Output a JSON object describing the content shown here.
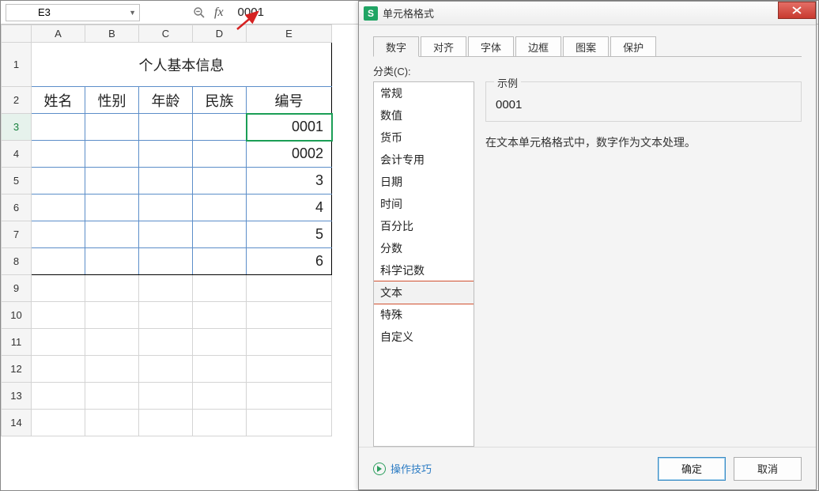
{
  "formula_bar": {
    "cell_ref": "E3",
    "fx_label": "fx",
    "value": "0001"
  },
  "columns": [
    "A",
    "B",
    "C",
    "D",
    "E"
  ],
  "row_headers": [
    1,
    2,
    3,
    4,
    5,
    6,
    7,
    8,
    9,
    10,
    11,
    12,
    13,
    14
  ],
  "selected_row_header": 3,
  "table": {
    "title": "个人基本信息",
    "headers": [
      "姓名",
      "性别",
      "年龄",
      "民族",
      "编号"
    ],
    "rows": [
      [
        "",
        "",
        "",
        "",
        "0001"
      ],
      [
        "",
        "",
        "",
        "",
        "0002"
      ],
      [
        "",
        "",
        "",
        "",
        "3"
      ],
      [
        "",
        "",
        "",
        "",
        "4"
      ],
      [
        "",
        "",
        "",
        "",
        "5"
      ],
      [
        "",
        "",
        "",
        "",
        "6"
      ]
    ]
  },
  "dialog": {
    "app_icon_letter": "S",
    "title": "单元格格式",
    "tabs": [
      "数字",
      "对齐",
      "字体",
      "边框",
      "图案",
      "保护"
    ],
    "active_tab": 0,
    "category_label": "分类(C):",
    "categories": [
      "常规",
      "数值",
      "货币",
      "会计专用",
      "日期",
      "时间",
      "百分比",
      "分数",
      "科学记数",
      "文本",
      "特殊",
      "自定义"
    ],
    "selected_category_index": 9,
    "example_legend": "示例",
    "example_value": "0001",
    "description": "在文本单元格格式中，数字作为文本处理。",
    "tips_label": "操作技巧",
    "ok_label": "确定",
    "cancel_label": "取消"
  }
}
